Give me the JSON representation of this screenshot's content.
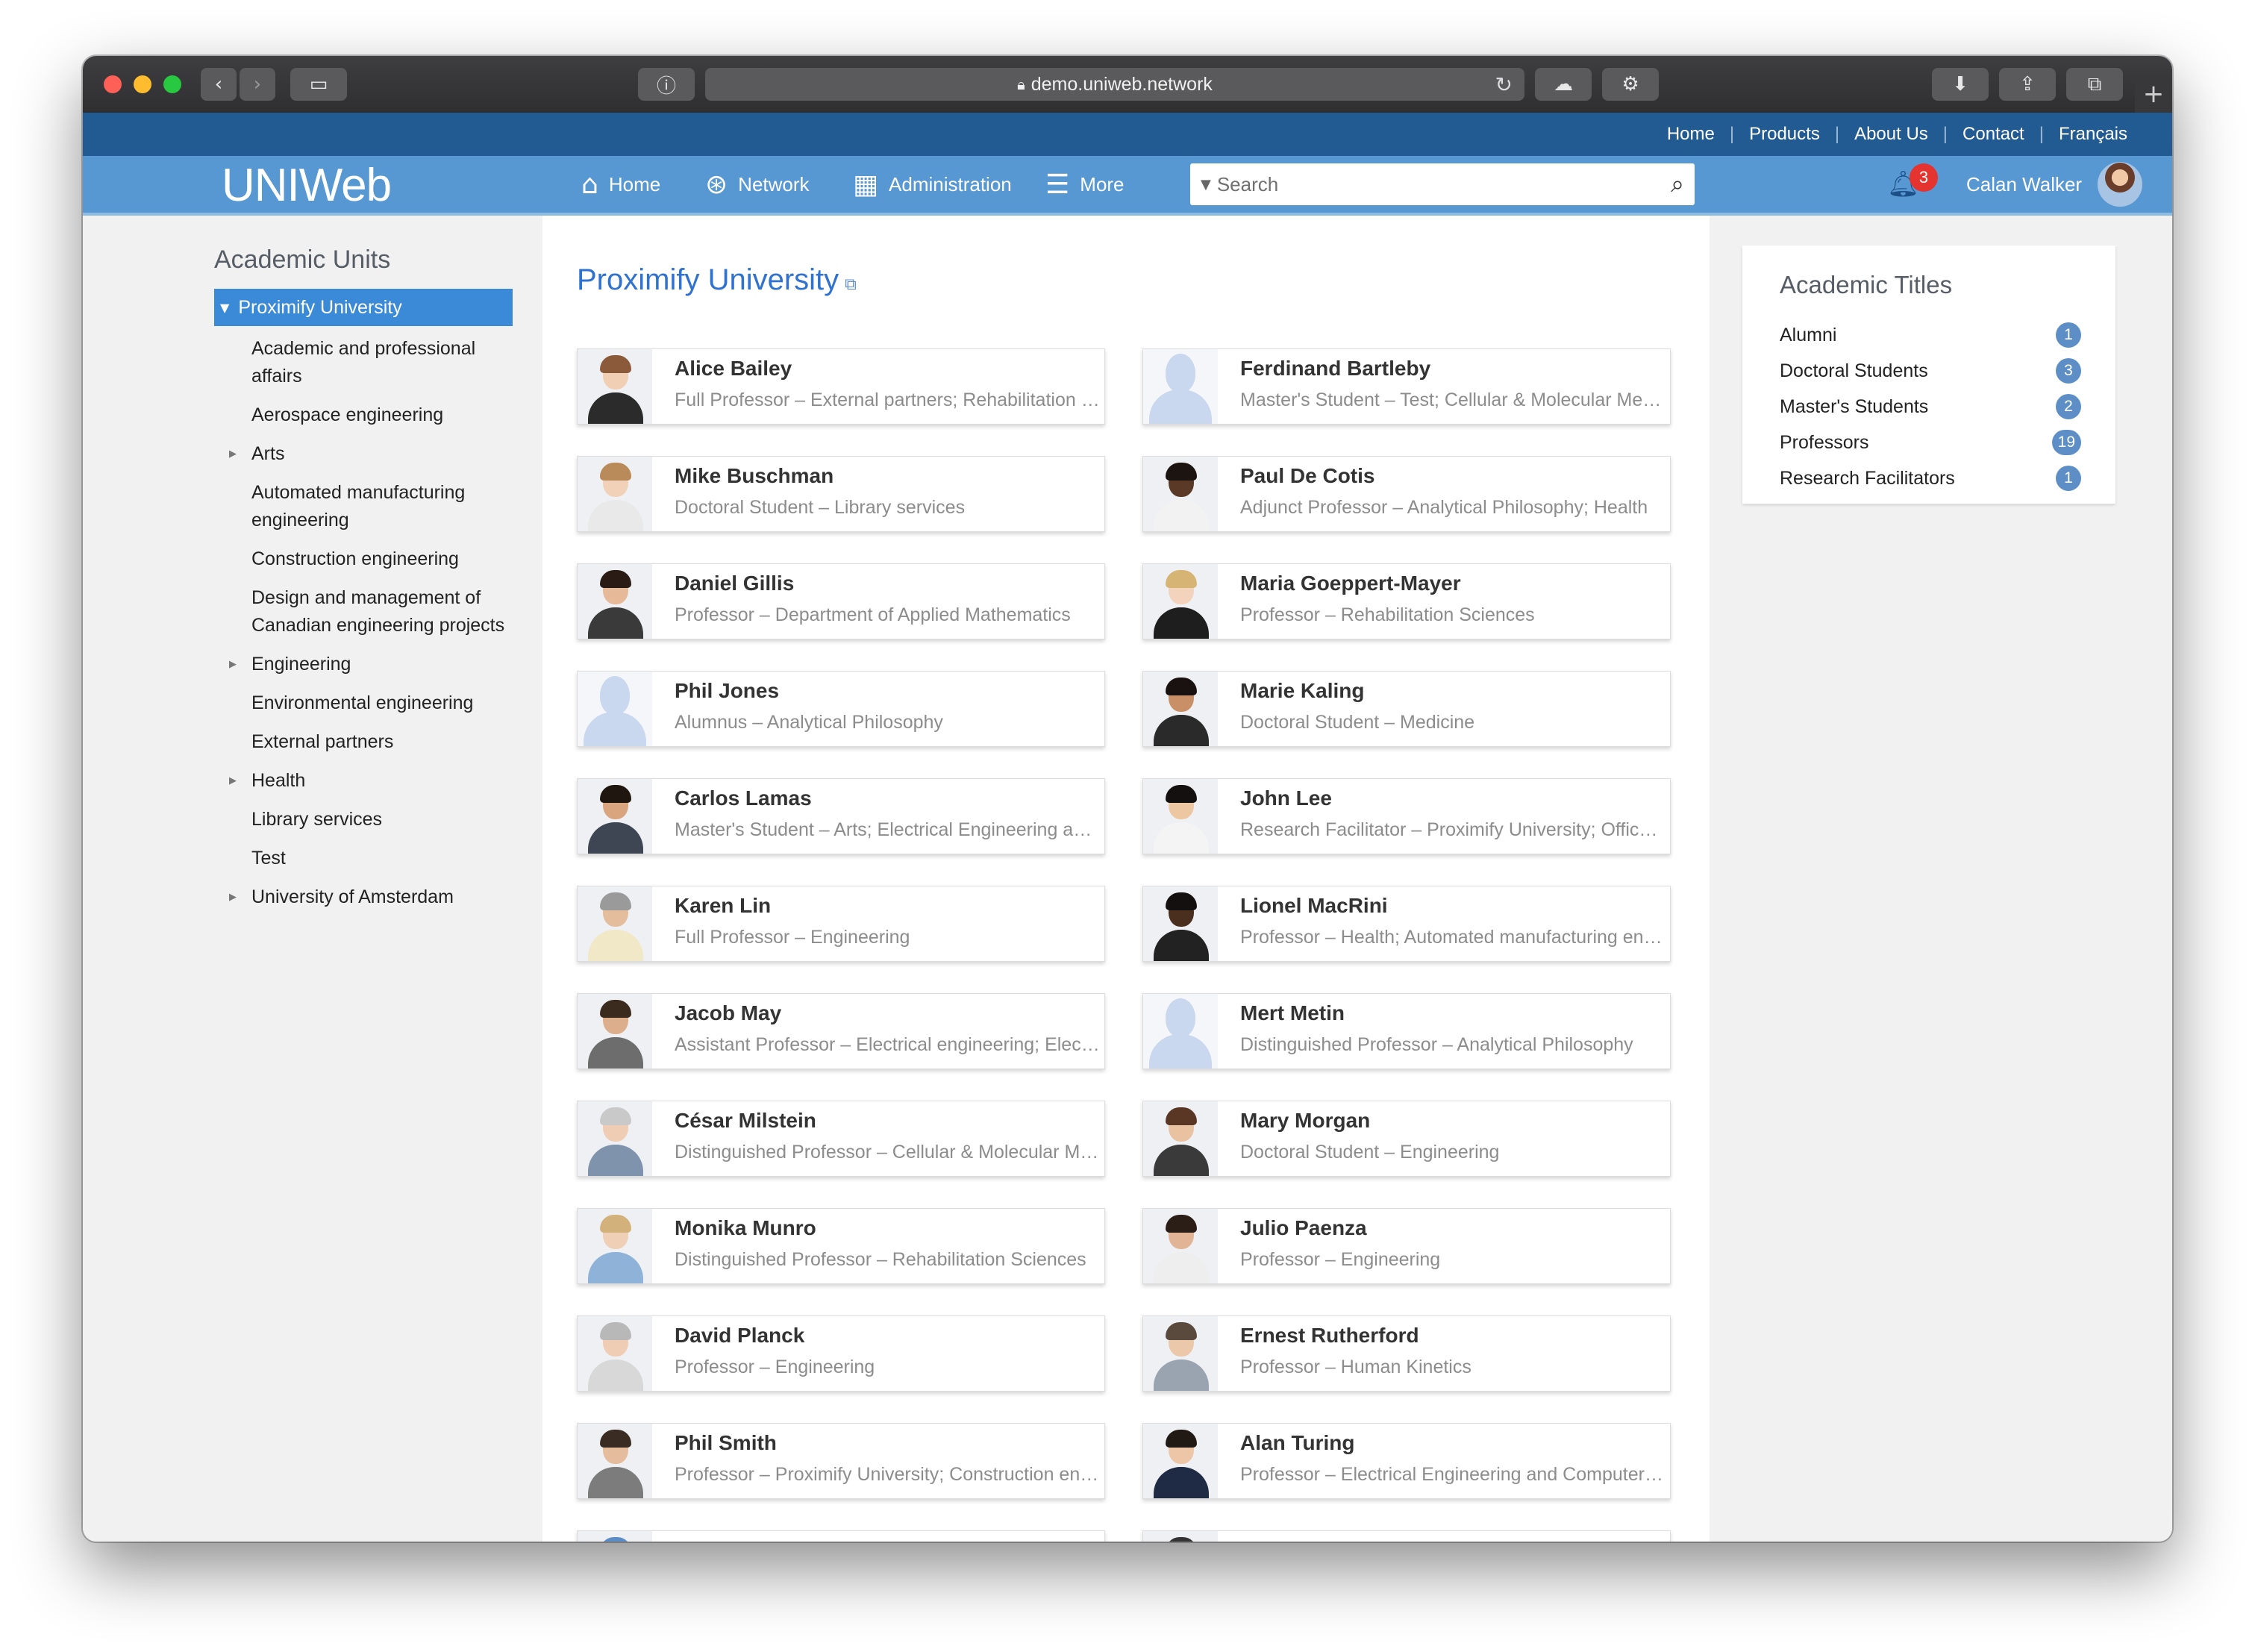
{
  "browser": {
    "url": "demo.uniweb.network"
  },
  "topbar": {
    "links": [
      "Home",
      "Products",
      "About Us",
      "Contact",
      "Français"
    ]
  },
  "nav": {
    "logo": "UNIWeb",
    "home": "Home",
    "network": "Network",
    "administration": "Administration",
    "more": "More",
    "search_placeholder": "Search",
    "notifications": "3",
    "user_name": "Calan Walker"
  },
  "sidebar": {
    "title": "Academic Units",
    "active": "Proximify University",
    "items": [
      {
        "label": "Academic and professional affairs",
        "expandable": false
      },
      {
        "label": "Aerospace engineering",
        "expandable": false
      },
      {
        "label": "Arts",
        "expandable": true
      },
      {
        "label": "Automated manufacturing engineering",
        "expandable": false
      },
      {
        "label": "Construction engineering",
        "expandable": false
      },
      {
        "label": "Design and management of Canadian engineering projects",
        "expandable": false
      },
      {
        "label": "Engineering",
        "expandable": true
      },
      {
        "label": "Environmental engineering",
        "expandable": false
      },
      {
        "label": "External partners",
        "expandable": false
      },
      {
        "label": "Health",
        "expandable": true
      },
      {
        "label": "Library services",
        "expandable": false
      },
      {
        "label": "Test",
        "expandable": false
      },
      {
        "label": "University of Amsterdam",
        "expandable": true
      }
    ]
  },
  "main": {
    "title": "Proximify University",
    "people": [
      {
        "name": "Alice Bailey",
        "subtitle": "Full Professor – External partners; Rehabilitation Sciences",
        "photo": "photo",
        "skin": "#f0cfb5",
        "hair": "#8a5a3a",
        "shirt": "#2b2b2b"
      },
      {
        "name": "Ferdinand Bartleby",
        "subtitle": "Master's Student – Test; Cellular & Molecular Medicine",
        "photo": "placeholder"
      },
      {
        "name": "Mike Buschman",
        "subtitle": "Doctoral Student – Library services",
        "photo": "photo",
        "skin": "#f1d2b8",
        "hair": "#b98b5a",
        "shirt": "#e9e9e9"
      },
      {
        "name": "Paul De Cotis",
        "subtitle": "Adjunct Professor – Analytical Philosophy; Health",
        "photo": "photo",
        "skin": "#5a3a26",
        "hair": "#1c1410",
        "shirt": "#f2f2f2"
      },
      {
        "name": "Daniel Gillis",
        "subtitle": "Professor – Department of Applied Mathematics",
        "photo": "photo",
        "skin": "#e6b999",
        "hair": "#2a1c14",
        "shirt": "#3a3a3a"
      },
      {
        "name": "Maria Goeppert-Mayer",
        "subtitle": "Professor – Rehabilitation Sciences",
        "photo": "photo",
        "skin": "#f3d3bb",
        "hair": "#d6b474",
        "shirt": "#1e1e1e"
      },
      {
        "name": "Phil Jones",
        "subtitle": "Alumnus – Analytical Philosophy",
        "photo": "placeholder"
      },
      {
        "name": "Marie Kaling",
        "subtitle": "Doctoral Student – Medicine",
        "photo": "photo",
        "skin": "#c98f66",
        "hair": "#1a1210",
        "shirt": "#2a2a2a"
      },
      {
        "name": "Carlos Lamas",
        "subtitle": "Master's Student – Arts; Electrical Engineering and Computer Science",
        "photo": "photo",
        "skin": "#d9a57f",
        "hair": "#1f1610",
        "shirt": "#3d4652"
      },
      {
        "name": "John Lee",
        "subtitle": "Research Facilitator – Proximify University; Office of Research",
        "photo": "photo",
        "skin": "#ecc7a2",
        "hair": "#141010",
        "shirt": "#f4f4f4"
      },
      {
        "name": "Karen Lin",
        "subtitle": "Full Professor – Engineering",
        "photo": "photo",
        "skin": "#e3bd9c",
        "hair": "#9a9a9a",
        "shirt": "#f1e8c8"
      },
      {
        "name": "Lionel MacRini",
        "subtitle": "Professor – Health; Automated manufacturing engineering",
        "photo": "photo",
        "skin": "#4a2f1f",
        "hair": "#151010",
        "shirt": "#222222"
      },
      {
        "name": "Jacob May",
        "subtitle": "Assistant Professor – Electrical engineering; Electrical Engineering",
        "photo": "photo",
        "skin": "#dcae8c",
        "hair": "#3b2a1e",
        "shirt": "#6d6d6d"
      },
      {
        "name": "Mert Metin",
        "subtitle": "Distinguished Professor – Analytical Philosophy",
        "photo": "placeholder"
      },
      {
        "name": "César Milstein",
        "subtitle": "Distinguished Professor – Cellular & Molecular Medicine",
        "photo": "photo",
        "skin": "#efcdb4",
        "hair": "#c9c9c9",
        "shirt": "#7f93ad"
      },
      {
        "name": "Mary Morgan",
        "subtitle": "Doctoral Student – Engineering",
        "photo": "photo",
        "skin": "#e9c2a2",
        "hair": "#5a3624",
        "shirt": "#3a3a3a"
      },
      {
        "name": "Monika Munro",
        "subtitle": "Distinguished Professor – Rehabilitation Sciences",
        "photo": "photo",
        "skin": "#efcfb6",
        "hair": "#d2b27a",
        "shirt": "#8fb2d8"
      },
      {
        "name": "Julio Paenza",
        "subtitle": "Professor – Engineering",
        "photo": "photo",
        "skin": "#e0b494",
        "hair": "#2a1e16",
        "shirt": "#eeeeee"
      },
      {
        "name": "David Planck",
        "subtitle": "Professor – Engineering",
        "photo": "photo",
        "skin": "#efcdb4",
        "hair": "#b8b8b8",
        "shirt": "#d8d8d8"
      },
      {
        "name": "Ernest Rutherford",
        "subtitle": "Professor – Human Kinetics",
        "photo": "photo",
        "skin": "#ecc8aa",
        "hair": "#5a4a3e",
        "shirt": "#9aa4b0"
      },
      {
        "name": "Phil Smith",
        "subtitle": "Professor – Proximify University; Construction engineering",
        "photo": "photo",
        "skin": "#e5bc9c",
        "hair": "#3a2c22",
        "shirt": "#7c7c7c"
      },
      {
        "name": "Alan Turing",
        "subtitle": "Professor – Electrical Engineering and Computer Science",
        "photo": "photo",
        "skin": "#ecc6a6",
        "hair": "#211a14",
        "shirt": "#1f2a44"
      },
      {
        "name": "",
        "subtitle": "",
        "photo": "photo",
        "skin": "#8fb4de",
        "hair": "#5c8cc6",
        "shirt": "#5c8cc6"
      },
      {
        "name": "",
        "subtitle": "",
        "photo": "photo",
        "skin": "#ffffff",
        "hair": "#333333",
        "shirt": "#ffffff"
      }
    ]
  },
  "academic_titles": {
    "title": "Academic Titles",
    "items": [
      {
        "label": "Alumni",
        "count": "1"
      },
      {
        "label": "Doctoral Students",
        "count": "3"
      },
      {
        "label": "Master's Students",
        "count": "2"
      },
      {
        "label": "Professors",
        "count": "19"
      },
      {
        "label": "Research Facilitators",
        "count": "1"
      }
    ]
  },
  "colors": {
    "topbar": "#225b92",
    "navbar": "#5798d3",
    "accent": "#3b8ad8",
    "title": "#2f72cf",
    "badge": "#5d8fc6",
    "notification": "#e53330"
  }
}
